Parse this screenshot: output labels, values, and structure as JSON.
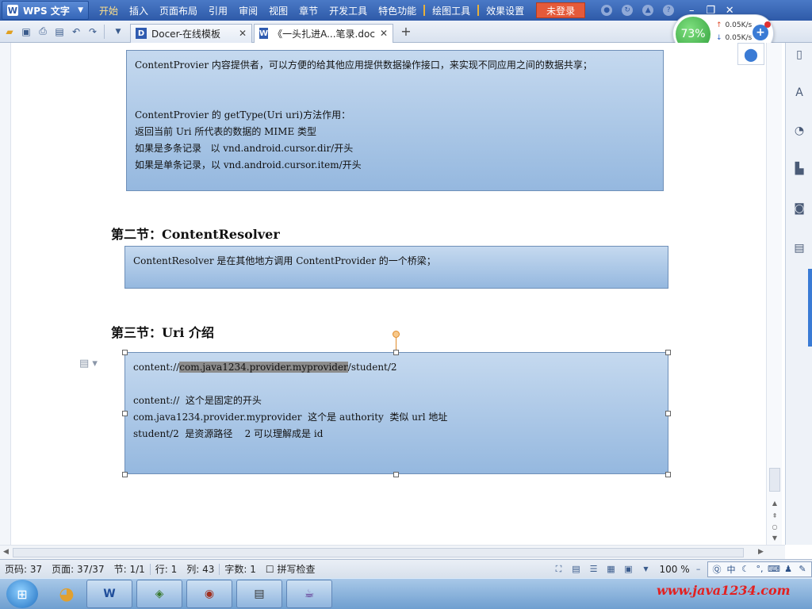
{
  "app": {
    "name": "WPS 文字",
    "logo": "W"
  },
  "menu": {
    "items": [
      "开始",
      "插入",
      "页面布局",
      "引用",
      "审阅",
      "视图",
      "章节",
      "开发工具",
      "特色功能"
    ],
    "draw_tools": "绘图工具",
    "effect_settings": "效果设置",
    "login": "未登录"
  },
  "tabs": [
    {
      "icon_text": "D",
      "label": "Docer-在线模板",
      "icon_color": "#2f5bb0"
    },
    {
      "icon_text": "W",
      "label": "《一头扎进A...笔录.doc",
      "icon_color": "#2f5bb0"
    }
  ],
  "speed_widget": {
    "percent": "73%",
    "upload": "0.05K/s",
    "download": "0.05K/s"
  },
  "document": {
    "box1_lines": [
      "ContentProvier 内容提供者，可以方便的给其他应用提供数据操作接口，来实现不同应用之间的数据共享；",
      "",
      "",
      "ContentProvier 的 getType(Uri uri)方法作用：",
      "返回当前 Uri 所代表的数据的 MIME 类型",
      "如果是多条记录   以 vnd.android.cursor.dir/开头",
      "如果是单条记录，以 vnd.android.cursor.item/开头"
    ],
    "heading2": "第二节：ContentResolver",
    "box2_lines": [
      "ContentResolver 是在其他地方调用 ContentProvider 的一个桥梁；"
    ],
    "heading3": "第三节：Uri 介绍",
    "box3": {
      "uri_prefix": "content://",
      "uri_selected": "com.java1234.provider.myprovider",
      "uri_suffix": "/student/2",
      "lines": [
        "",
        "content://  这个是固定的开头",
        "com.java1234.provider.myprovider  这个是 authority  类似 url 地址",
        "student/2  是资源路径    2 可以理解成是 id"
      ]
    }
  },
  "status": {
    "page_code": "页码: 37",
    "page": "页面: 37/37",
    "section": "节: 1/1",
    "line": "行: 1",
    "col": "列: 43",
    "words": "字数: 1",
    "spell": "拼写检查",
    "zoom": "100 %"
  },
  "ime": {
    "mode": "中"
  },
  "taskbar": {
    "watermark": "www.java1234.com"
  }
}
